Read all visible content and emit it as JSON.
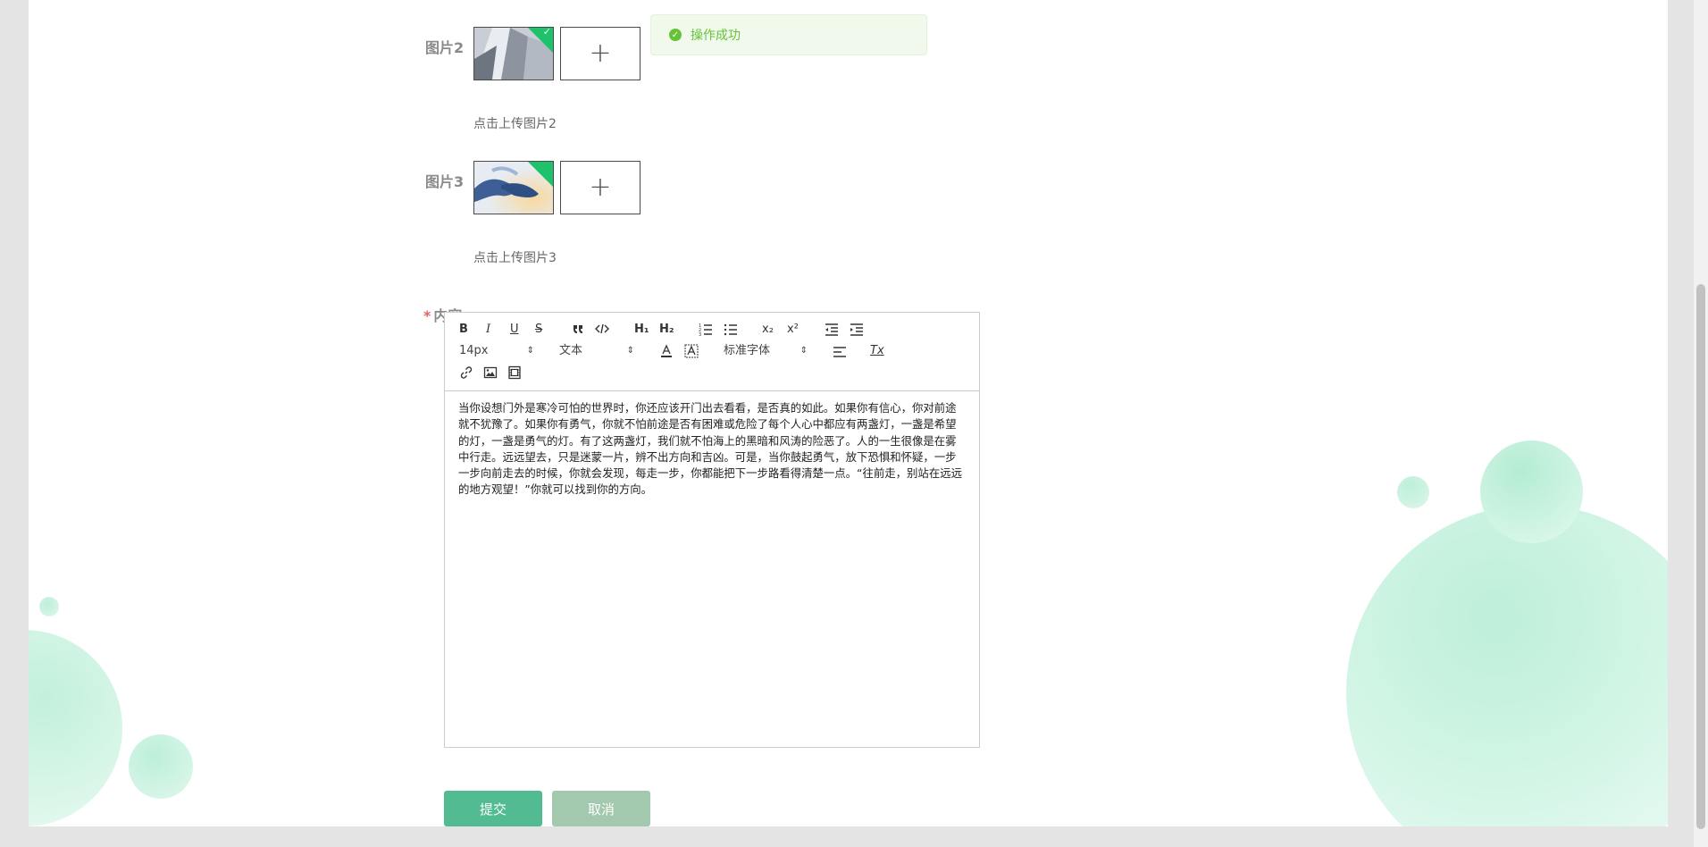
{
  "toast": {
    "message": "操作成功",
    "icon": "check-circle-icon"
  },
  "image2": {
    "label": "图片2",
    "hint": "点击上传图片2"
  },
  "image3": {
    "label": "图片3",
    "hint": "点击上传图片3"
  },
  "content_field": {
    "required_mark": "*",
    "label": "内容",
    "text": "当你设想门外是寒冷可怕的世界时，你还应该开门出去看看，是否真的如此。如果你有信心，你对前途就不犹豫了。如果你有勇气，你就不怕前途是否有困难或危险了每个人心中都应有两盏灯，一盏是希望的灯，一盏是勇气的灯。有了这两盏灯，我们就不怕海上的黑暗和风涛的险恶了。人的一生很像是在雾中行走。远远望去，只是迷蒙一片，辨不出方向和吉凶。可是，当你鼓起勇气，放下恐惧和怀疑，一步一步向前走去的时候，你就会发现，每走一步，你都能把下一步路看得清楚一点。“往前走，别站在远远的地方观望！”你就可以找到你的方向。"
  },
  "toolbar": {
    "bold": "B",
    "italic": "I",
    "underline": "U",
    "strike": "S",
    "h1": "H₁",
    "h2": "H₂",
    "sub": "x₂",
    "sup": "x²",
    "font_size": "14px",
    "header": "文本",
    "font_family": "标准字体",
    "clean": "Tx"
  },
  "buttons": {
    "submit": "提交",
    "cancel": "取消"
  },
  "colors": {
    "primary": "#52bb92",
    "cancel": "#a2c9ae",
    "success": "#67c23a"
  }
}
